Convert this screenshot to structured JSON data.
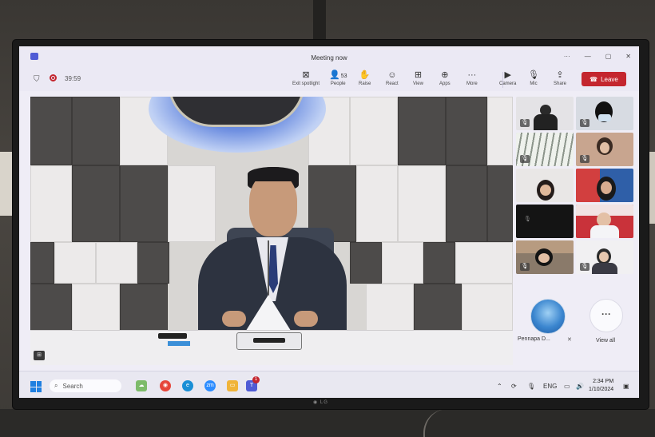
{
  "window": {
    "title": "Meeting now",
    "controls": [
      "···",
      "—",
      "▢",
      "✕"
    ]
  },
  "toolbar": {
    "timer": "39:59",
    "exit_spotlight_label": "Exit spotlight",
    "people_label": "People",
    "people_count": "53",
    "raise_label": "Raise",
    "react_label": "React",
    "view_label": "View",
    "apps_label": "Apps",
    "more_label": "More",
    "camera_label": "Camera",
    "mic_label": "Mic",
    "share_label": "Share",
    "leave_label": "Leave"
  },
  "gallery": {
    "pinned_name": "Pennapa D...",
    "view_all_label": "View all"
  },
  "taskbar": {
    "search_placeholder": "Search",
    "badge_count": "1",
    "language": "ENG",
    "time": "2:34 PM",
    "date": "1/10/2024"
  },
  "colors": {
    "leave": "#c4262e",
    "accent": "#4f5bd5",
    "windows_blue": "#1f7fe0"
  },
  "icons": [
    "shield-icon",
    "record-icon",
    "exit-spotlight-icon",
    "people-icon",
    "raise-hand-icon",
    "react-icon",
    "view-icon",
    "apps-icon",
    "more-icon",
    "camera-icon",
    "mic-icon",
    "share-icon",
    "phone-hangup-icon",
    "muted-mic-icon",
    "search-icon",
    "chevron-up-icon",
    "speaker-icon",
    "notification-icon"
  ]
}
